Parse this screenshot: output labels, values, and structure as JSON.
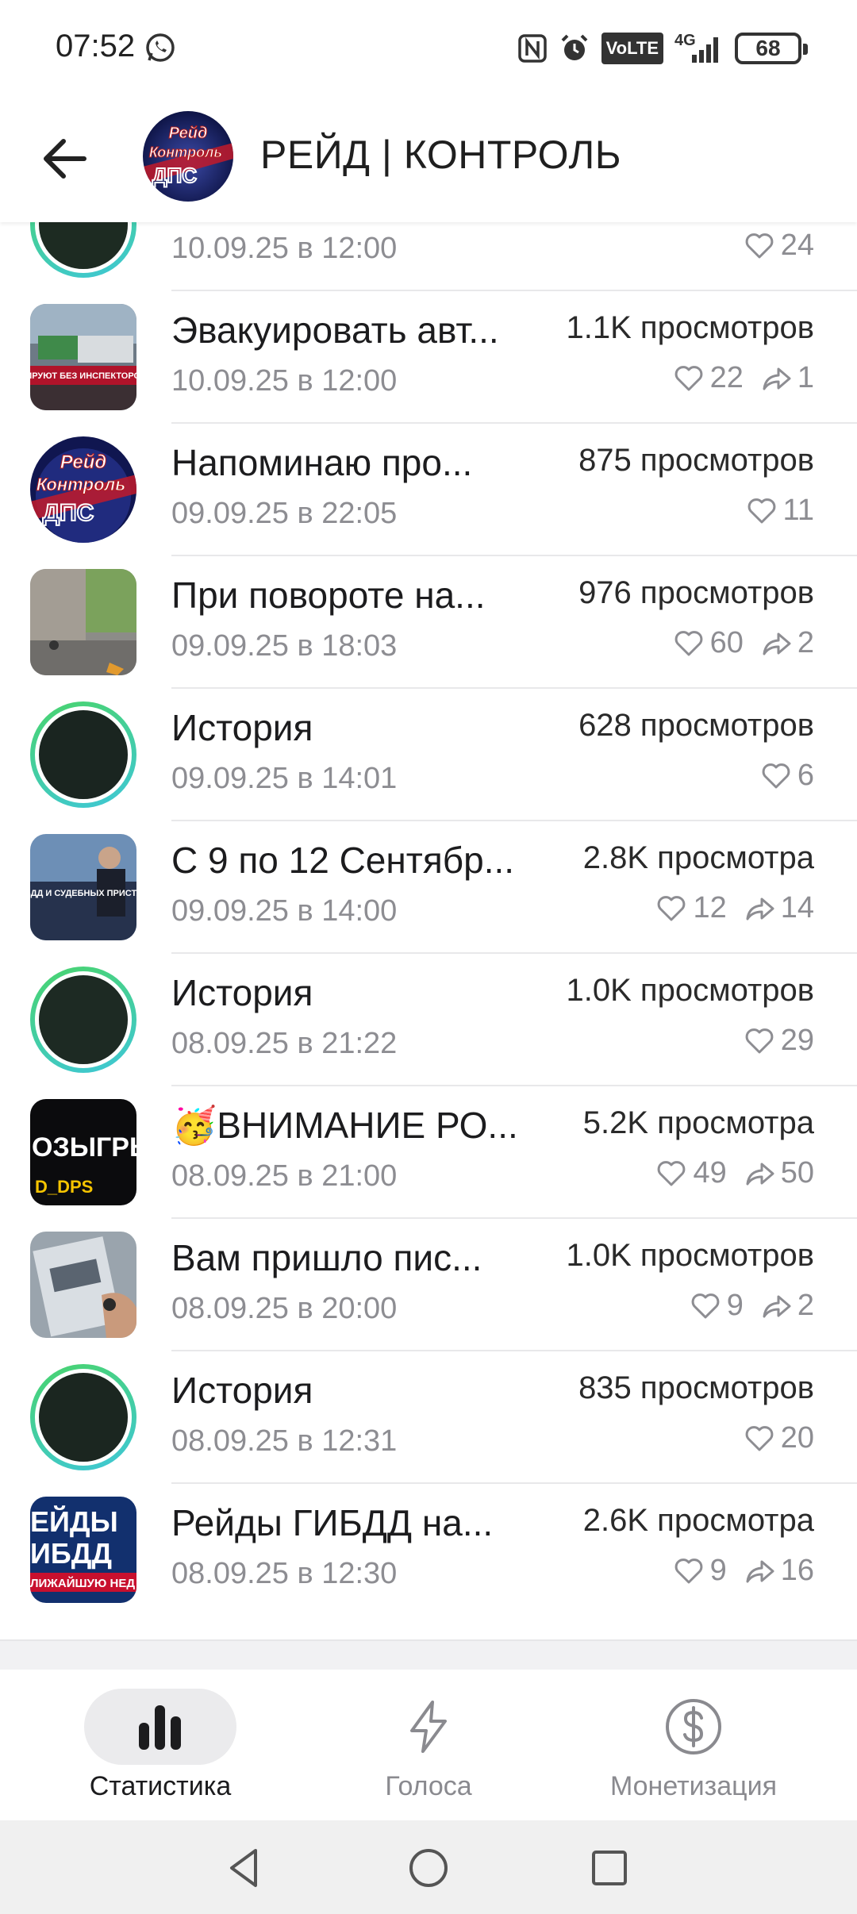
{
  "status": {
    "time": "07:52",
    "network": "4G",
    "volte": "VoLTE",
    "battery": "68"
  },
  "header": {
    "title": "РЕЙД | КОНТРОЛЬ",
    "avatar_text_1": "Рейд",
    "avatar_text_2": "Контроль",
    "avatar_text_3": "ДПС"
  },
  "posts": [
    {
      "title": "",
      "views": "",
      "date": "10.09.25 в 12:00",
      "likes": "24",
      "shares": "",
      "thumb": "story"
    },
    {
      "title": "Эвакуировать авт...",
      "views": "1.1K просмотров",
      "date": "10.09.25 в 12:00",
      "likes": "22",
      "shares": "1",
      "thumb": "photo",
      "thumb_text": "РИРУЮТ БЕЗ ИНСПЕКТОРОВ"
    },
    {
      "title": "Напоминаю про...",
      "views": "875 просмотров",
      "date": "09.09.25 в 22:05",
      "likes": "11",
      "shares": "",
      "thumb": "logo"
    },
    {
      "title": "При повороте на...",
      "views": "976 просмотров",
      "date": "09.09.25 в 18:03",
      "likes": "60",
      "shares": "2",
      "thumb": "photo"
    },
    {
      "title": "История",
      "views": "628 просмотров",
      "date": "09.09.25 в 14:01",
      "likes": "6",
      "shares": "",
      "thumb": "story"
    },
    {
      "title": "С 9 по 12 Сентябр...",
      "views": "2.8K просмотра",
      "date": "09.09.25 в 14:00",
      "likes": "12",
      "shares": "14",
      "thumb": "photo",
      "thumb_text": "РЕЙДЫ ГИБДД И СУДЕБНЫХ ПРИСТАВОВ"
    },
    {
      "title": "История",
      "views": "1.0K просмотров",
      "date": "08.09.25 в 21:22",
      "likes": "29",
      "shares": "",
      "thumb": "story"
    },
    {
      "title": "🥳ВНИМАНИЕ РО...",
      "views": "5.2K просмотра",
      "date": "08.09.25 в 21:00",
      "likes": "49",
      "shares": "50",
      "thumb": "dark",
      "thumb_text": "ОЗЫГРЫ",
      "thumb_text2": "D_DPS"
    },
    {
      "title": "Вам пришло пис...",
      "views": "1.0K просмотров",
      "date": "08.09.25 в 20:00",
      "likes": "9",
      "shares": "2",
      "thumb": "photo"
    },
    {
      "title": "История",
      "views": "835 просмотров",
      "date": "08.09.25 в 12:31",
      "likes": "20",
      "shares": "",
      "thumb": "story"
    },
    {
      "title": "Рейды ГИБДД на...",
      "views": "2.6K просмотра",
      "date": "08.09.25 в 12:30",
      "likes": "9",
      "shares": "16",
      "thumb": "blue",
      "thumb_text": "ЕЙДЫ",
      "thumb_text2": "ИБДД",
      "thumb_text3": "ЛИЖАЙШУЮ НЕД"
    }
  ],
  "bottom_nav": {
    "stats": "Статистика",
    "voices": "Голоса",
    "monetization": "Монетизация"
  }
}
